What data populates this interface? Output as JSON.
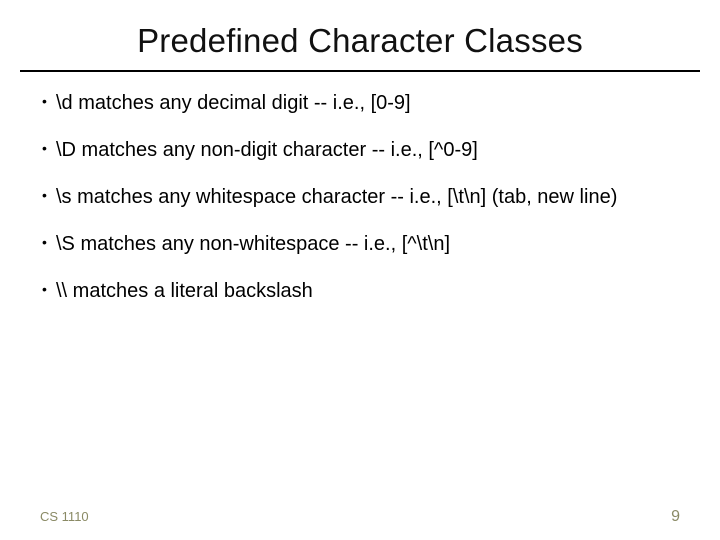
{
  "title": "Predefined Character Classes",
  "bullets": [
    "\\d   matches any decimal digit -- i.e., [0-9]",
    "\\D  matches any non-digit character -- i.e., [^0-9]",
    "\\s   matches any whitespace character -- i.e., [\\t\\n] (tab, new line)",
    "\\S   matches any non-whitespace -- i.e., [^\\t\\n]",
    "\\\\   matches a literal backslash"
  ],
  "footer": {
    "course": "CS 1110",
    "page": "9"
  }
}
